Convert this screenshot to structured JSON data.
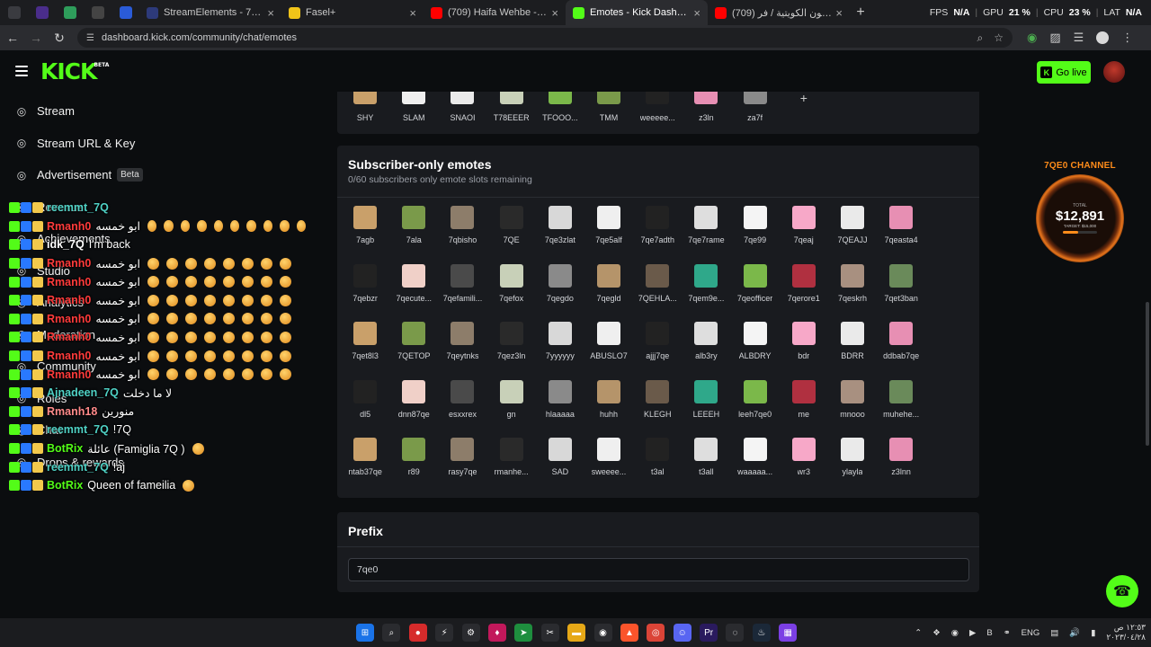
{
  "browser": {
    "tabs": [
      {
        "title": "StreamElements - 7qe0",
        "color": "#2d3a7a",
        "active": false
      },
      {
        "title": "Fasel+",
        "color": "#f0c419",
        "active": false
      },
      {
        "title": "(709) Haifa Wehbe - Touta (Offi",
        "color": "#ff0000",
        "active": false
      },
      {
        "title": "Emotes - Kick Dashboard",
        "color": "#53fc18",
        "active": true
      },
      {
        "title": "(709) فرقة التلفزيون الكويتية / فر",
        "color": "#ff0000",
        "active": false
      }
    ],
    "mini_tab_colors": [
      "#3a3b40",
      "#4a2d8a",
      "#2e9d5b",
      "#444",
      "#2a5bd7"
    ],
    "new_tab": "+",
    "close_glyph": "×",
    "url": "dashboard.kick.com/community/chat/emotes",
    "perf": {
      "fps_label": "FPS",
      "fps": "N/A",
      "gpu_label": "GPU",
      "gpu": "21 %",
      "cpu_label": "CPU",
      "cpu": "23 %",
      "lat_label": "LAT",
      "lat": "N/A"
    }
  },
  "kick": {
    "logo": "KICK",
    "logo_badge": "BETA",
    "go_live": "Go live",
    "nav": [
      {
        "label": "Stream",
        "icon": "stream-icon"
      },
      {
        "label": "Stream URL & Key",
        "icon": "link-icon"
      },
      {
        "label": "Advertisement",
        "icon": "ad-icon",
        "badge": "Beta"
      },
      {
        "label": "Revenue",
        "icon": "revenue-icon"
      },
      {
        "label": "Achievements",
        "icon": "achievements-icon"
      },
      {
        "label": "Studio",
        "icon": "studio-icon"
      },
      {
        "label": "Analytics",
        "icon": "analytics-icon"
      },
      {
        "label": "Moderation",
        "icon": "moderation-icon"
      },
      {
        "label": "Community",
        "icon": "community-icon"
      },
      {
        "label": "Roles",
        "icon": "roles-icon"
      },
      {
        "label": "Chat",
        "icon": "chat-icon"
      },
      {
        "label": "Drops & rewards",
        "icon": "drops-icon"
      }
    ],
    "top_emotes": [
      "SHY",
      "SLAM",
      "SNAOI",
      "T78EEER",
      "TFOOO...",
      "TMM",
      "weeeee...",
      "z3ln",
      "za7f"
    ],
    "add_glyph": "+",
    "subscriber_title": "Subscriber-only emotes",
    "subscriber_subtitle": "0/60 subscribers only emote slots remaining",
    "emotes": [
      "7agb",
      "7ala",
      "7qbisho",
      "7QE",
      "7qe3zlat",
      "7qe5alf",
      "7qe7adth",
      "7qe7rame",
      "7qe99",
      "7qeaj",
      "7QEAJJ",
      "7qeasta4",
      "7qebzr",
      "7qecute...",
      "7qefamili...",
      "7qefox",
      "7qegdo",
      "7qegld",
      "7QEHLA...",
      "7qem9e...",
      "7qeofficer",
      "7qerore1",
      "7qeskrh",
      "7qet3ban",
      "7qet8l3",
      "7QETOP",
      "7qeytnks",
      "7qez3ln",
      "7yyyyyy",
      "ABUSLO7",
      "ajjj7qe",
      "alb3ry",
      "ALBDRY",
      "bdr",
      "BDRR",
      "ddbab7qe",
      "dl5",
      "dnn87qe",
      "esxxrex",
      "gn",
      "hlaaaaa",
      "huhh",
      "KLEGH",
      "LEEEH",
      "leeh7qe0",
      "me",
      "mnooo",
      "muhehe...",
      "ntab37qe",
      "r89",
      "rasy7qe",
      "rmanhe...",
      "SAD",
      "sweeee...",
      "t3al",
      "t3all",
      "waaaaa...",
      "wr3",
      "ylayla",
      "z3lnn"
    ],
    "prefix_title": "Prefix",
    "prefix_value": "7qe0"
  },
  "chat": [
    {
      "user": "reemmt_7Q",
      "color": "#4fd1c5",
      "msg": "",
      "emotes": 0
    },
    {
      "user": "Rmanh0",
      "color": "#ff3b3b",
      "msg": "ابو خمسه",
      "emotes": 10
    },
    {
      "user": "idk_7Q",
      "color": "#ffffff",
      "msg": "I'm back",
      "emotes": 0
    },
    {
      "user": "Rmanh0",
      "color": "#ff3b3b",
      "msg": "ابو خمسه",
      "emotes": 8
    },
    {
      "user": "Rmanh0",
      "color": "#ff3b3b",
      "msg": "ابو خمسه",
      "emotes": 8
    },
    {
      "user": "Rmanh0",
      "color": "#ff3b3b",
      "msg": "ابو خمسه",
      "emotes": 8
    },
    {
      "user": "Rmanh0",
      "color": "#ff3b3b",
      "msg": "ابو خمسه",
      "emotes": 8
    },
    {
      "user": "Rmanh0",
      "color": "#ff3b3b",
      "msg": "ابو خمسه",
      "emotes": 8
    },
    {
      "user": "Rmanh0",
      "color": "#ff3b3b",
      "msg": "ابو خمسه",
      "emotes": 8
    },
    {
      "user": "Rmanh0",
      "color": "#ff3b3b",
      "msg": "ابو خمسه",
      "emotes": 8
    },
    {
      "user": "Ajnadeen_7Q",
      "color": "#4fd1c5",
      "msg": "لا ما دخلت",
      "emotes": 0
    },
    {
      "user": "Rmanh18",
      "color": "#ff8a8a",
      "msg": "منورين",
      "emotes": 0
    },
    {
      "user": "reemmt_7Q",
      "color": "#4fd1c5",
      "msg": "!7Q",
      "emotes": 0
    },
    {
      "user": "BotRix",
      "color": "#53fc18",
      "msg": "عائلة (Famiglia 7Q )",
      "emotes": 1
    },
    {
      "user": "reemmt_7Q",
      "color": "#4fd1c5",
      "msg": "!aj",
      "emotes": 0
    },
    {
      "user": "BotRix",
      "color": "#53fc18",
      "msg": "Queen of fameilia",
      "emotes": 1
    }
  ],
  "widget": {
    "title": "7QE0 CHANNEL",
    "small": "TOTAL",
    "amount": "$12,891",
    "target": "TARGET: $15,000",
    "progress": 0.45
  },
  "taskbar": {
    "apps": [
      {
        "name": "windows-start-icon",
        "color": "#1a73e8",
        "glyph": "⊞"
      },
      {
        "name": "search-icon",
        "color": "#2a2b2f",
        "glyph": "⌕"
      },
      {
        "name": "app-red-icon",
        "color": "#d62b2b",
        "glyph": "●"
      },
      {
        "name": "app-bolt-icon",
        "color": "#2a2b2f",
        "glyph": "⚡"
      },
      {
        "name": "settings-icon",
        "color": "#2a2b2f",
        "glyph": "⚙"
      },
      {
        "name": "app-pink-icon",
        "color": "#c2185b",
        "glyph": "♦"
      },
      {
        "name": "app-green-icon",
        "color": "#1e8e3e",
        "glyph": "➤"
      },
      {
        "name": "app-snip-icon",
        "color": "#2a2b2f",
        "glyph": "✂"
      },
      {
        "name": "folder-icon",
        "color": "#e6a817",
        "glyph": "▬"
      },
      {
        "name": "obs-icon",
        "color": "#2a2b2f",
        "glyph": "◉"
      },
      {
        "name": "brave-icon",
        "color": "#fb542b",
        "glyph": "▲"
      },
      {
        "name": "chrome-icon",
        "color": "#db4437",
        "glyph": "◎"
      },
      {
        "name": "discord-icon",
        "color": "#5865f2",
        "glyph": "☺"
      },
      {
        "name": "premiere-icon",
        "color": "#2a1a5e",
        "glyph": "Pr"
      },
      {
        "name": "app-circle-icon",
        "color": "#2a2b2f",
        "glyph": "◌"
      },
      {
        "name": "steam-icon",
        "color": "#1b2838",
        "glyph": "♨"
      },
      {
        "name": "app-grid-icon",
        "color": "#7b3fe4",
        "glyph": "▦"
      }
    ],
    "lang": "ENG",
    "time": "١٢:٥٣ ص",
    "date": "٢٠٢٣/٠٤/٢٨"
  },
  "colors": {
    "accent": "#53fc18",
    "panel": "#191b1f",
    "background": "#0b0d0f"
  }
}
